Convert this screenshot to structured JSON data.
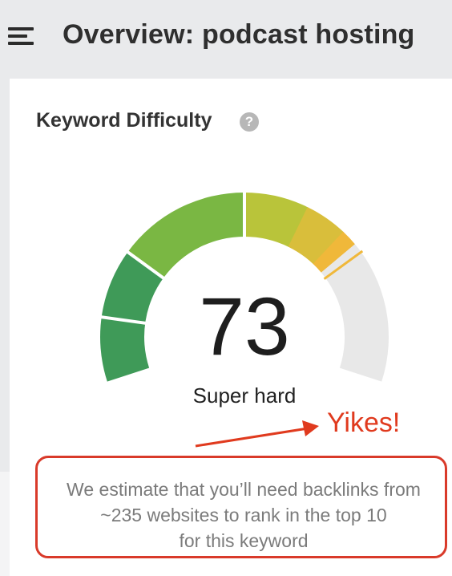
{
  "header": {
    "title": "Overview: podcast hosting",
    "menu_icon": "hamburger-menu-icon"
  },
  "widget": {
    "title": "Keyword Difficulty",
    "help_icon": "question-mark-icon",
    "help_glyph": "?",
    "score": "73",
    "score_max": 100,
    "rating": "Super hard",
    "estimate_lines": [
      "We estimate that you’ll need backlinks from",
      "~235 websites to rank in the top 10",
      "for this keyword"
    ]
  },
  "annotation": {
    "text": "Yikes!",
    "color": "#e03a1e"
  },
  "colors": {
    "gauge_green": "#3f9a58",
    "gauge_yellow_green": "#b9c43a",
    "gauge_orange": "#f0b83a",
    "gauge_empty": "#e8e8e8",
    "highlight_red": "#d93a2a"
  }
}
